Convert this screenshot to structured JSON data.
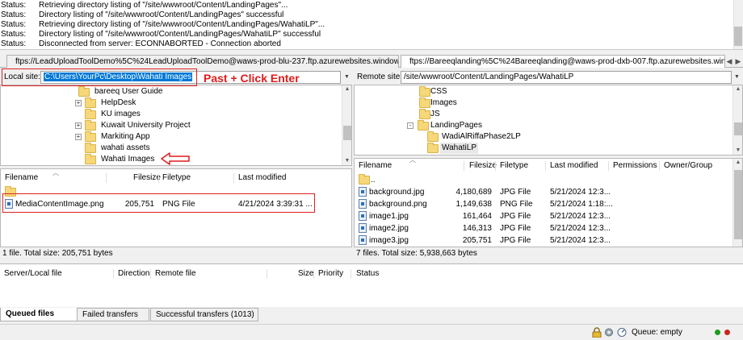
{
  "log": {
    "rows": [
      {
        "label": "Status:",
        "text": "Retrieving directory listing of \"/site/wwwroot/Content/LandingPages\"..."
      },
      {
        "label": "Status:",
        "text": "Directory listing of \"/site/wwwroot/Content/LandingPages\" successful"
      },
      {
        "label": "Status:",
        "text": "Retrieving directory listing of \"/site/wwwroot/Content/LandingPages/WahatiLP\"..."
      },
      {
        "label": "Status:",
        "text": "Directory listing of \"/site/wwwroot/Content/LandingPages/WahatiLP\" successful"
      },
      {
        "label": "Status:",
        "text": "Disconnected from server: ECONNABORTED - Connection aborted"
      }
    ]
  },
  "tabs": [
    {
      "label": "ftps://LeadUploadToolDemo%5C%24LeadUploadToolDemo@waws-prod-blu-237.ftp.azurewebsites.windows.net"
    },
    {
      "label": "ftps://Bareeqlanding%5C%24Bareeqlanding@waws-prod-dxb-007.ftp.azurewebsites.windows."
    }
  ],
  "local": {
    "site_label": "Local site:",
    "site_value": "C:\\Users\\YourPc\\Desktop\\Wahati Images",
    "tree": [
      {
        "label": "bareeq User Guide",
        "expander": ""
      },
      {
        "label": "HelpDesk",
        "expander": "+"
      },
      {
        "label": "KU images",
        "expander": ""
      },
      {
        "label": "Kuwait University Project",
        "expander": "+"
      },
      {
        "label": "Markiting App",
        "expander": "+"
      },
      {
        "label": "wahati assets",
        "expander": ""
      },
      {
        "label": "Wahati Images",
        "expander": ""
      }
    ],
    "columns": {
      "filename": "Filename",
      "filesize": "Filesize",
      "filetype": "Filetype",
      "modified": "Last modified"
    },
    "files": [
      {
        "name": "..",
        "size": "",
        "type": "",
        "modified": ""
      },
      {
        "name": "MediaContentImage.png",
        "size": "205,751",
        "type": "PNG File",
        "modified": "4/21/2024 3:39:31 ..."
      }
    ],
    "status": "1 file. Total size: 205,751 bytes"
  },
  "remote": {
    "site_label": "Remote site:",
    "site_value": "/site/wwwroot/Content/LandingPages/WahatiLP",
    "tree": [
      {
        "label": "CSS",
        "expander": ""
      },
      {
        "label": "Images",
        "expander": ""
      },
      {
        "label": "JS",
        "expander": ""
      },
      {
        "label": "LandingPages",
        "expander": "-"
      },
      {
        "label": "WadiAlRiffaPhase2LP",
        "expander": ""
      },
      {
        "label": "WahatiLP",
        "expander": ""
      }
    ],
    "columns": {
      "filename": "Filename",
      "filesize": "Filesize",
      "filetype": "Filetype",
      "modified": "Last modified",
      "permissions": "Permissions",
      "owner": "Owner/Group"
    },
    "files": [
      {
        "name": "..",
        "size": "",
        "type": "",
        "modified": ""
      },
      {
        "name": "background.jpg",
        "size": "4,180,689",
        "type": "JPG File",
        "modified": "5/21/2024 12:3..."
      },
      {
        "name": "background.png",
        "size": "1,149,638",
        "type": "PNG File",
        "modified": "5/21/2024 1:18:..."
      },
      {
        "name": "image1.jpg",
        "size": "161,464",
        "type": "JPG File",
        "modified": "5/21/2024 12:3..."
      },
      {
        "name": "image2.jpg",
        "size": "146,313",
        "type": "JPG File",
        "modified": "5/21/2024 12:3..."
      },
      {
        "name": "image3.jpg",
        "size": "205,751",
        "type": "JPG File",
        "modified": "5/21/2024 12:3..."
      }
    ],
    "status": "7 files. Total size: 5,938,663 bytes"
  },
  "annotation": {
    "text": "Past + Click Enter"
  },
  "queue": {
    "columns": {
      "server": "Server/Local file",
      "direction": "Direction",
      "remote": "Remote file",
      "size": "Size",
      "priority": "Priority",
      "status": "Status"
    },
    "tabs": [
      "Queued files",
      "Failed transfers",
      "Successful transfers (1013)"
    ],
    "status": "Queue: empty"
  },
  "colors": {
    "selection": "#0078d7",
    "annotation": "#e01b1b",
    "folder": "#f6d779"
  }
}
